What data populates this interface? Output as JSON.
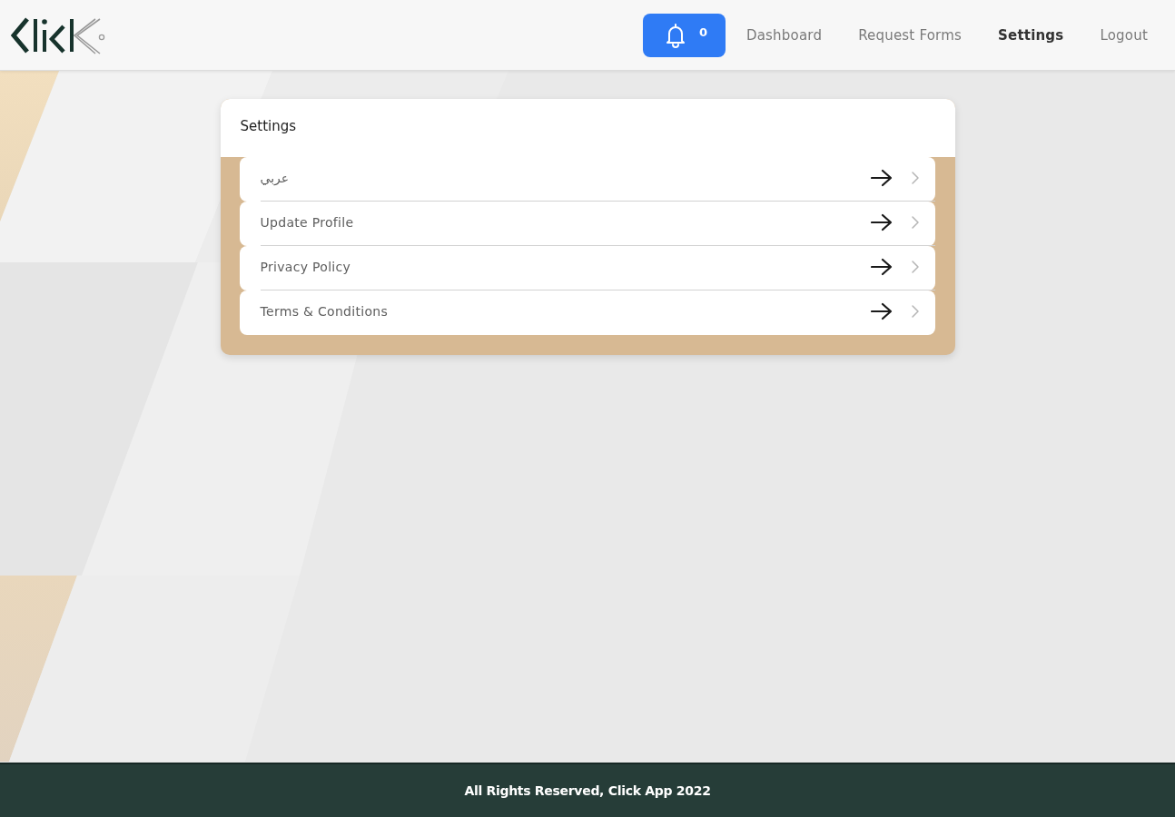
{
  "header": {
    "notifications": {
      "count": "0"
    },
    "nav": [
      {
        "label": "Dashboard",
        "selected": false
      },
      {
        "label": "Request Forms",
        "selected": false
      },
      {
        "label": "Settings",
        "selected": true
      },
      {
        "label": "Logout",
        "selected": false
      }
    ]
  },
  "settings_card": {
    "title": "Settings",
    "items": [
      {
        "label": "عربي"
      },
      {
        "label": "Update Profile"
      },
      {
        "label": "Privacy Policy"
      },
      {
        "label": "Terms & Conditions"
      }
    ]
  },
  "footer": {
    "text": "All Rights Reserved, Click App 2022"
  }
}
